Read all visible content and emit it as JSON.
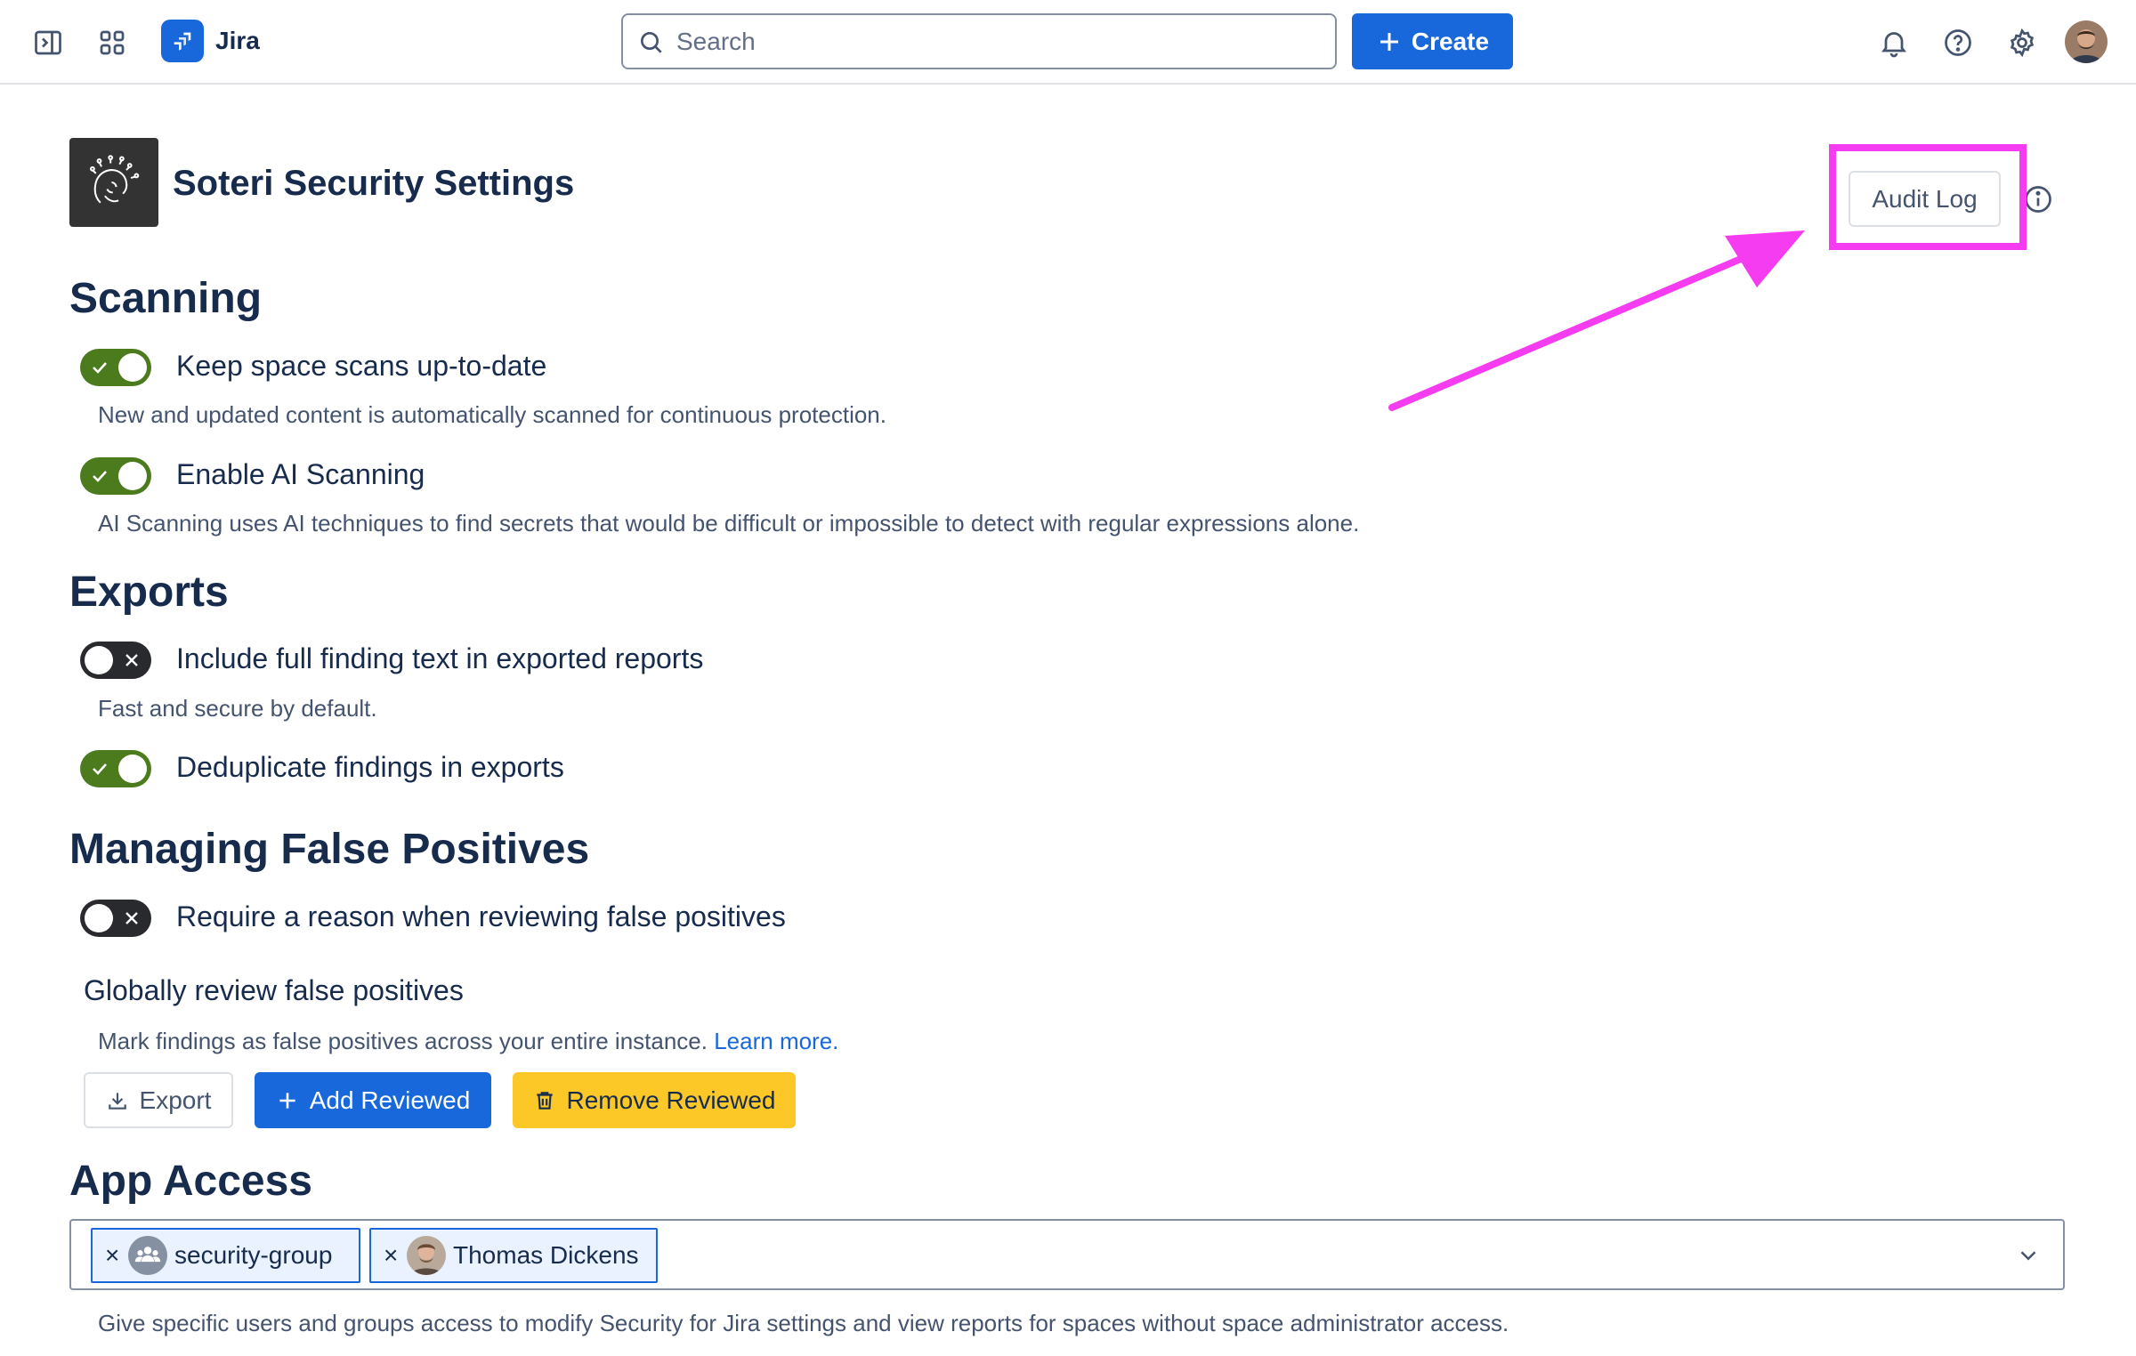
{
  "topbar": {
    "app_name": "Jira",
    "search_placeholder": "Search",
    "create_label": "Create"
  },
  "header": {
    "title": "Soteri Security Settings",
    "audit_log_label": "Audit Log"
  },
  "scanning": {
    "title": "Scanning",
    "items": [
      {
        "label": "Keep space scans up-to-date",
        "enabled": true,
        "description": "New and updated content is automatically scanned for continuous protection."
      },
      {
        "label": "Enable AI Scanning",
        "enabled": true,
        "description": "AI Scanning uses AI techniques to find secrets that would be difficult or impossible to detect with regular expressions alone."
      }
    ]
  },
  "exports": {
    "title": "Exports",
    "items": [
      {
        "label": "Include full finding text in exported reports",
        "enabled": false,
        "description": "Fast and secure by default."
      },
      {
        "label": "Deduplicate findings in exports",
        "enabled": true
      }
    ]
  },
  "false_positives": {
    "title": "Managing False Positives",
    "require_reason": {
      "label": "Require a reason when reviewing false positives",
      "enabled": false
    },
    "global_title": "Globally review false positives",
    "global_description": "Mark findings as false positives across your entire instance.",
    "learn_more": "Learn more.",
    "export_label": "Export",
    "add_label": "Add Reviewed",
    "remove_label": "Remove Reviewed"
  },
  "app_access": {
    "title": "App Access",
    "chips": [
      {
        "label": "security-group",
        "type": "group"
      },
      {
        "label": "Thomas Dickens",
        "type": "user"
      }
    ],
    "description": "Give specific users and groups access to modify Security for Jira settings and view reports for spaces without space administrator access."
  },
  "colors": {
    "brand_blue": "#1868db",
    "toggle_on": "#4c7b1e",
    "toggle_off": "#292a2e",
    "warning_yellow": "#fbc828",
    "annotation_magenta": "#f53cf0"
  },
  "icons": [
    "sidebar-toggle-icon",
    "app-switcher-icon",
    "jira-logo-icon",
    "search-icon",
    "plus-icon",
    "bell-icon",
    "help-icon",
    "gear-icon",
    "info-icon",
    "download-icon",
    "trash-icon",
    "chevron-down-icon",
    "group-icon"
  ]
}
